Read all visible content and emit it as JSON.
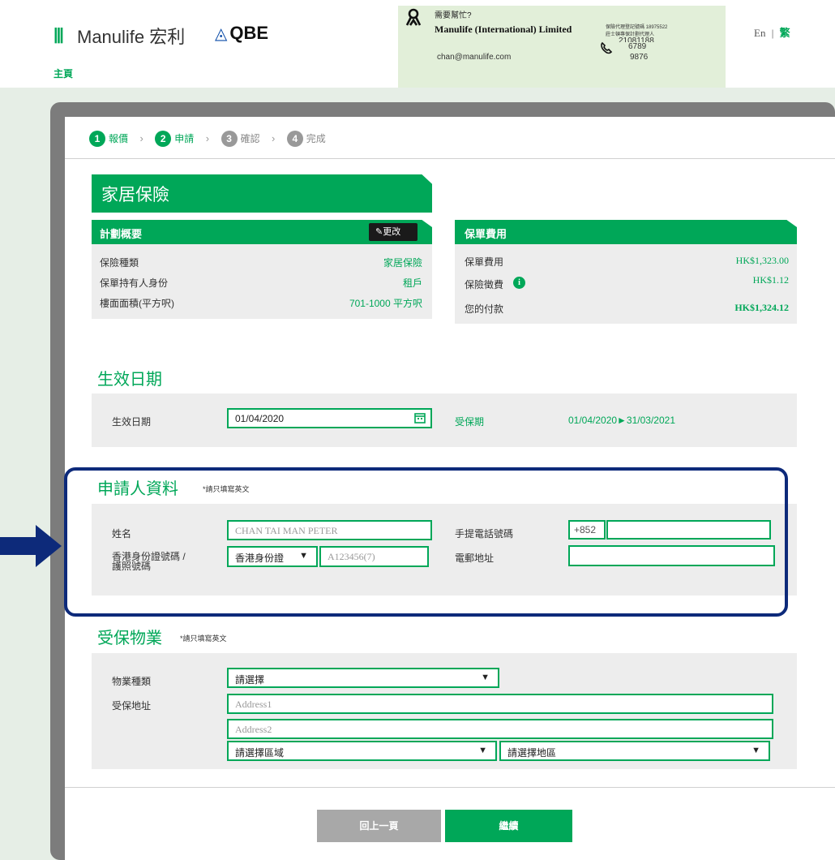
{
  "header": {
    "logo_bars": "|||",
    "logo_text": "Manulife 宏利",
    "partner_text": "QBE",
    "contact": {
      "help": "需要幫忙?",
      "company": "Manulife (International) Limited",
      "reg_line1": "保險代理登記號碼 18975522",
      "reg_line2": "莊士頓專保計劃代理人",
      "phone_partial": "21081188",
      "phone_lines": [
        "6789",
        "9876"
      ],
      "email": "chan@manulife.com"
    },
    "lang": {
      "en": "En",
      "sep": "|",
      "zh": "繁"
    },
    "breadcrumb_home": "主頁"
  },
  "steps": [
    {
      "num": "1",
      "label": "報價",
      "active": true
    },
    {
      "num": "2",
      "label": "申請",
      "active": true
    },
    {
      "num": "3",
      "label": "確認",
      "active": false
    },
    {
      "num": "4",
      "label": "完成",
      "active": false
    }
  ],
  "product_title": "家居保險",
  "plan_summary": {
    "title": "計劃概要",
    "edit_label": "更改",
    "rows": [
      {
        "label": "保險種類",
        "value": "家居保險"
      },
      {
        "label": "保單持有人身份",
        "value": "租戶"
      },
      {
        "label": "樓面面積(平方呎)",
        "value": "701-1000 平方呎"
      }
    ]
  },
  "premium": {
    "title": "保單費用",
    "rows": [
      {
        "label": "保單費用",
        "value": "HK$1,323.00"
      },
      {
        "label": "保險徵費",
        "value": "HK$1.12"
      },
      {
        "label": "您的付款",
        "value": "HK$1,324.12"
      }
    ]
  },
  "effective": {
    "title": "生效日期",
    "label": "生效日期",
    "date": "01/04/2020",
    "period_label": "受保期",
    "period_value": "01/04/2020►31/03/2021"
  },
  "applicant": {
    "title": "申請人資料",
    "note": "*請只填寫英文",
    "name_label": "姓名",
    "name_placeholder": "CHAN TAI MAN PETER",
    "id_label_1": "香港身份證號碼 /",
    "id_label_2": "護照號碼",
    "id_type": "香港身份證",
    "id_placeholder": "A123456(7)",
    "mobile_label": "手提電話號碼",
    "country_code": "+852",
    "mobile_value": "",
    "email_label": "電郵地址",
    "email_value": ""
  },
  "property": {
    "title": "受保物業",
    "note": "*請只填寫英文",
    "type_label": "物業種類",
    "type_value": "請選擇",
    "address_label": "受保地址",
    "address1_placeholder": "Address1",
    "address2_placeholder": "Address2",
    "region_value": "請選擇區域",
    "district_value": "請選擇地區"
  },
  "buttons": {
    "back": "回上一頁",
    "continue": "繼續"
  },
  "colors": {
    "brand_green": "#00a758",
    "highlight_navy": "#0d2a7a",
    "contact_bg": "#e2efd9"
  }
}
